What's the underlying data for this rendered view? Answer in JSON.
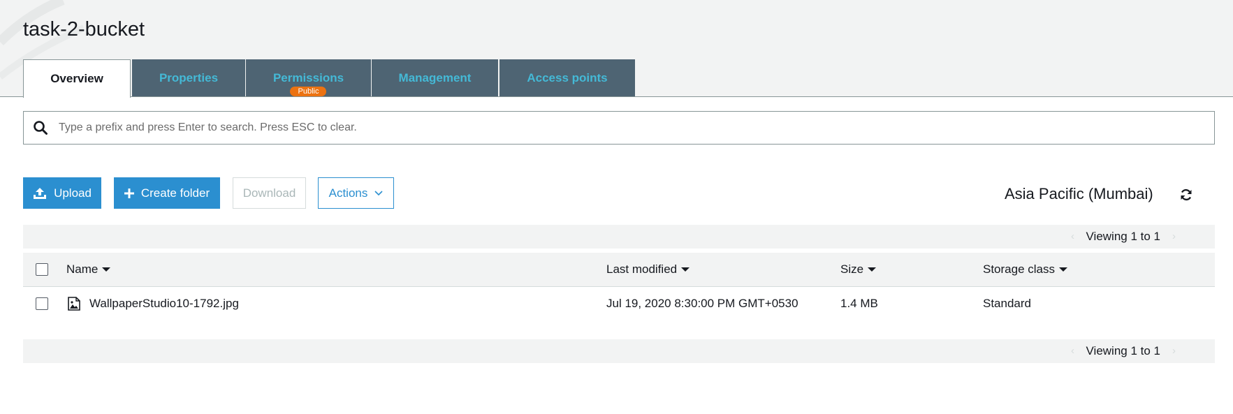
{
  "bucket": {
    "title": "task-2-bucket"
  },
  "tabs": [
    {
      "label": "Overview",
      "active": true
    },
    {
      "label": "Properties"
    },
    {
      "label": "Permissions",
      "badge": "Public"
    },
    {
      "label": "Management"
    },
    {
      "label": "Access points"
    }
  ],
  "search": {
    "placeholder": "Type a prefix and press Enter to search. Press ESC to clear.",
    "value": ""
  },
  "toolbar": {
    "upload_label": "Upload",
    "create_folder_label": "Create folder",
    "download_label": "Download",
    "actions_label": "Actions"
  },
  "region": "Asia Pacific (Mumbai)",
  "pager": {
    "text": "Viewing 1 to 1"
  },
  "table": {
    "columns": [
      "Name",
      "Last modified",
      "Size",
      "Storage class"
    ],
    "rows": [
      {
        "name": "WallpaperStudio10-1792.jpg",
        "last_modified": "Jul 19, 2020 8:30:00 PM GMT+0530",
        "size": "1.4 MB",
        "storage_class": "Standard"
      }
    ]
  },
  "colors": {
    "tab_bg": "#4e6473",
    "tab_text": "#44b9d6",
    "primary": "#2b8fd0",
    "badge": "#ec7211",
    "band": "#f2f3f3"
  },
  "icons": [
    "search-icon",
    "upload-icon",
    "plus-icon",
    "chevron-down-icon",
    "refresh-icon",
    "image-file-icon",
    "sort-caret-icon",
    "chevron-left-icon",
    "chevron-right-icon"
  ]
}
